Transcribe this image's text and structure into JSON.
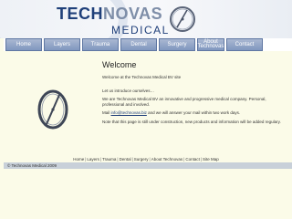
{
  "header": {
    "logo_tech": "TECH",
    "logo_novas": "NOVAS",
    "logo_medical": "MEDICAL"
  },
  "nav": [
    {
      "label": "Home"
    },
    {
      "label": "Layers"
    },
    {
      "label": "Trauma"
    },
    {
      "label": "Dental"
    },
    {
      "label": "Surgery"
    },
    {
      "label": "About Technovas"
    },
    {
      "label": "Contact"
    }
  ],
  "main": {
    "title": "Welcome",
    "p1": "Welcome at the Technovas Medical BV site",
    "p2": "Let us introduce ourselves…",
    "p3": "We are Technovas Medical BV an innovative and progressive medical company. Personal, professional and involved.",
    "mail_prefix": "Mail ",
    "mail_link": "info@technovas.biz",
    "mail_suffix": " and we will answer your mail within two work days.",
    "p5": "Note that this page is still under construction, new products and information will be added regulary."
  },
  "footer": {
    "links": [
      "Home",
      "Layers",
      "Trauma",
      "Dental",
      "Surgery",
      "About Technovas",
      "Contact",
      "Site Map"
    ],
    "copyright": "© Technovas Medical 2009"
  },
  "colors": {
    "brand": "#20407a",
    "nav_bg": "#8097bf",
    "page_bg": "#fbfbe8",
    "footer_bar": "#c8d0d9"
  }
}
